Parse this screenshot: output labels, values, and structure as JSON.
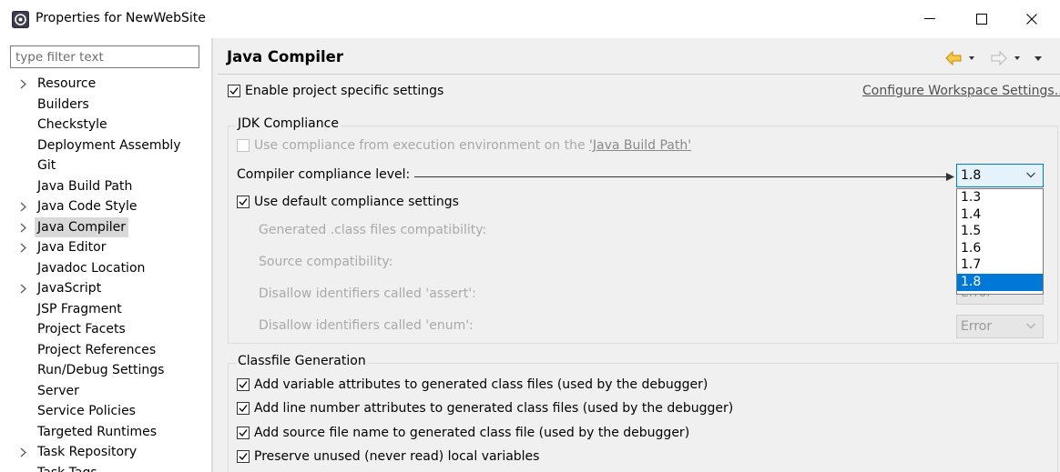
{
  "window": {
    "title": "Properties for NewWebSite"
  },
  "sidebar": {
    "filter_placeholder": "type filter text",
    "items": [
      {
        "label": "Resource",
        "expandable": true
      },
      {
        "label": "Builders",
        "expandable": false
      },
      {
        "label": "Checkstyle",
        "expandable": false
      },
      {
        "label": "Deployment Assembly",
        "expandable": false
      },
      {
        "label": "Git",
        "expandable": false
      },
      {
        "label": "Java Build Path",
        "expandable": false
      },
      {
        "label": "Java Code Style",
        "expandable": true
      },
      {
        "label": "Java Compiler",
        "expandable": true,
        "selected": true
      },
      {
        "label": "Java Editor",
        "expandable": true
      },
      {
        "label": "Javadoc Location",
        "expandable": false
      },
      {
        "label": "JavaScript",
        "expandable": true
      },
      {
        "label": "JSP Fragment",
        "expandable": false
      },
      {
        "label": "Project Facets",
        "expandable": false
      },
      {
        "label": "Project References",
        "expandable": false
      },
      {
        "label": "Run/Debug Settings",
        "expandable": false
      },
      {
        "label": "Server",
        "expandable": false
      },
      {
        "label": "Service Policies",
        "expandable": false
      },
      {
        "label": "Targeted Runtimes",
        "expandable": false
      },
      {
        "label": "Task Repository",
        "expandable": true
      },
      {
        "label": "Task Tags",
        "expandable": false
      }
    ]
  },
  "page": {
    "title": "Java Compiler",
    "enable_specific": "Enable project specific settings",
    "configure_link": "Configure Workspace Settings...",
    "jdk_group": {
      "title": "JDK Compliance",
      "use_env_prefix": "Use compliance from execution environment on the ",
      "use_env_link": "'Java Build Path'",
      "compliance_label": "Compiler compliance level:",
      "compliance_value": "1.8",
      "use_default": "Use default compliance settings",
      "generated_label": "Generated .class files compatibility:",
      "source_label": "Source compatibility:",
      "assert_label": "Disallow identifiers called 'assert':",
      "assert_value": "Error",
      "enum_label": "Disallow identifiers called 'enum':",
      "enum_value": "Error"
    },
    "dropdown_options": [
      "1.3",
      "1.4",
      "1.5",
      "1.6",
      "1.7",
      "1.8"
    ],
    "dropdown_selected": "1.8",
    "classfile_group": {
      "title": "Classfile Generation",
      "items": [
        "Add variable attributes to generated class files (used by the debugger)",
        "Add line number attributes to generated class files (used by the debugger)",
        "Add source file name to generated class file (used by the debugger)",
        "Preserve unused (never read) local variables"
      ]
    }
  },
  "colors": {
    "selection": "#0078d7",
    "nav_back": "#e8a317",
    "tree_selected": "#d9d9d9"
  }
}
